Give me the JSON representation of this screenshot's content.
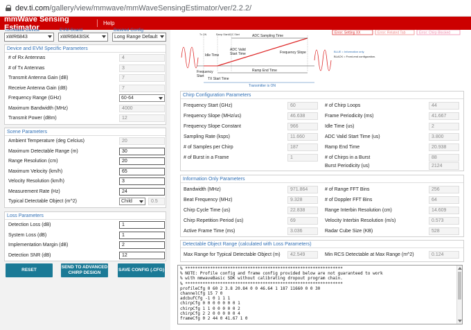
{
  "browser": {
    "url_host": "dev.ti.com",
    "url_path": "/gallery/view/mmwave/mmWaveSensingEstimator/ver/2.2.2/"
  },
  "app": {
    "title": "mmWave Sensing Estimator",
    "help": "Help"
  },
  "selectors": [
    {
      "label": "mmWave Device",
      "value": "xWR6843"
    },
    {
      "label": "EVM Board",
      "value": "xWR6843ISK"
    },
    {
      "label": "Desired Config",
      "value": "Long Range Default"
    }
  ],
  "device_params": {
    "heading": "Device and EVM Specific Parameters",
    "rows": [
      {
        "label": "# of Rx Antennas",
        "value": "4"
      },
      {
        "label": "# of Tx Antennas",
        "value": "3"
      },
      {
        "label": "Transmit Antenna Gain (dB)",
        "value": "7"
      },
      {
        "label": "Receive Antenna Gain (dB)",
        "value": "7"
      },
      {
        "label": "Frequency Range (GHz)",
        "value": "60-64"
      },
      {
        "label": "Maximum Bandwidth (MHz)",
        "value": "4000"
      },
      {
        "label": "Transmit Power (dBm)",
        "value": "12"
      }
    ]
  },
  "scene_params": {
    "heading": "Scene Parameters",
    "rows": [
      {
        "label": "Ambient Temperature (deg Celcius)",
        "value": "20"
      },
      {
        "label": "Maximum Detectable Range (m)",
        "value": "30"
      },
      {
        "label": "Range Resolution (cm)",
        "value": "20"
      },
      {
        "label": "Maximum Velocity (km/h)",
        "value": "65"
      },
      {
        "label": "Velocity Resolution (km/h)",
        "value": "3"
      },
      {
        "label": "Measurement Rate (Hz)",
        "value": "24"
      },
      {
        "label": "Typical Detectable Object (m^2)",
        "value": "Child",
        "value2": "0.5"
      }
    ]
  },
  "loss_params": {
    "heading": "Loss Parameters",
    "rows": [
      {
        "label": "Detection Loss (dB)",
        "value": "1"
      },
      {
        "label": "System Loss (dB)",
        "value": "1"
      },
      {
        "label": "Implementation Margin (dB)",
        "value": "2"
      },
      {
        "label": "Detection SNR (dB)",
        "value": "12"
      }
    ]
  },
  "buttons": {
    "reset": "RESET",
    "advanced": "SEND TO ADVANCED CHIRP DESIGN",
    "save": "SAVE CONFIG (.CFG)"
  },
  "diagram": {
    "top_buttons": [
      "Error: Setting XX",
      "Error: Related Tab",
      "Error: Chirp Blocked"
    ],
    "labels": {
      "tx_on": "Tx ON",
      "ramp_start": "Ramp Start",
      "adc_start": "ADC Start",
      "adc_sampling_time": "ADC Sampling Time",
      "idle_time": "Idle Time",
      "adc_valid": "ADC Valid",
      "start_time": "Start Time",
      "frequency_slope": "Frequency Slope",
      "frequency_start": "Frequency",
      "frequency_start2": "Start",
      "tx_start_time": "TX Start Time",
      "ramp_end_time": "Ramp End Time",
      "transmitter_on": "Transmitter is ON",
      "legend_blue": "BLUE = Information only.",
      "legend_black": "BLACK = Front-end configuration."
    }
  },
  "chirp_config": {
    "heading": "Chirp Configuration Parameters",
    "left": [
      {
        "label": "Frequency Start (GHz)",
        "value": "60"
      },
      {
        "label": "Frequency Slope (MHz/us)",
        "value": "46.638"
      },
      {
        "label": "Frequency Slope Constant",
        "value": "966"
      },
      {
        "label": "Sampling Rate (ksps)",
        "value": "11.660"
      },
      {
        "label": "# of Samples per Chirp",
        "value": "187"
      },
      {
        "label": "# of Burst in a Frame",
        "value": "1"
      }
    ],
    "right": [
      {
        "label": "# of Chirp Loops",
        "value": "44"
      },
      {
        "label": "Frame Periodicity (ms)",
        "value": "41.667"
      },
      {
        "label": "Idle Time (us)",
        "value": "2"
      },
      {
        "label": "ADC Valid Start Time (us)",
        "value": "3.800"
      },
      {
        "label": "Ramp End Time",
        "value": "20.938"
      },
      {
        "label": "# of Chirps in a Burst",
        "value": "88"
      },
      {
        "label": "Burst Periodicity (us)",
        "value": "2124"
      }
    ]
  },
  "info_only": {
    "heading": "Information Only Parameters",
    "left": [
      {
        "label": "Bandwidth (MHz)",
        "value": "971.864"
      },
      {
        "label": "Beat Frequency (MHz)",
        "value": "9.328"
      },
      {
        "label": "Chirp Cycle Time (us)",
        "value": "22.838"
      },
      {
        "label": "Chirp Repetition Period (us)",
        "value": "69"
      },
      {
        "label": "Active Frame Time (ms)",
        "value": "3.036"
      }
    ],
    "right": [
      {
        "label": "# of Range FFT Bins",
        "value": "256"
      },
      {
        "label": "# of Doppler FFT Bins",
        "value": "64"
      },
      {
        "label": "Range Interbin Resolution (cm)",
        "value": "14.609"
      },
      {
        "label": "Velocity Interbin Resolution (m/s)",
        "value": "0.573"
      },
      {
        "label": "Radar Cube Size (KB)",
        "value": "528"
      }
    ]
  },
  "detectable_range": {
    "heading": "Detectable Object Range (calculated with Loss Parameters)",
    "left": {
      "label": "Max Range for Typical Detectable Object (m)",
      "value": "42.549"
    },
    "right": {
      "label": "Min RCS Detectable at Max Range (m^2)",
      "value": "0.124"
    }
  },
  "console_lines": [
    "% ***************************************************************",
    "% NOTE: Profile config and frame config provided below are not guaranteed to work",
    "% with mmwaveBasic SDK without calibrating dropout program chain.",
    "% ***************************************************************",
    "profileCfg 0 60 2 3.8 20.84 0 0 46.64 1 187 11660 0 0 30",
    "channelCfg 15 7 0",
    "adcbufCfg -1 0 1 1 1",
    "chirpCfg 0 0 0 0 0 0 0 1",
    "chirpCfg 1 1 0 0 0 0 0 2",
    "chirpCfg 2 2 0 0 0 0 0 4",
    "frameCfg 0 2 44 0 41.67 1 0"
  ],
  "colors": {
    "header_red": "#cc0000",
    "button_teal": "#1b7a96",
    "label_blue": "#2f6fb5"
  }
}
